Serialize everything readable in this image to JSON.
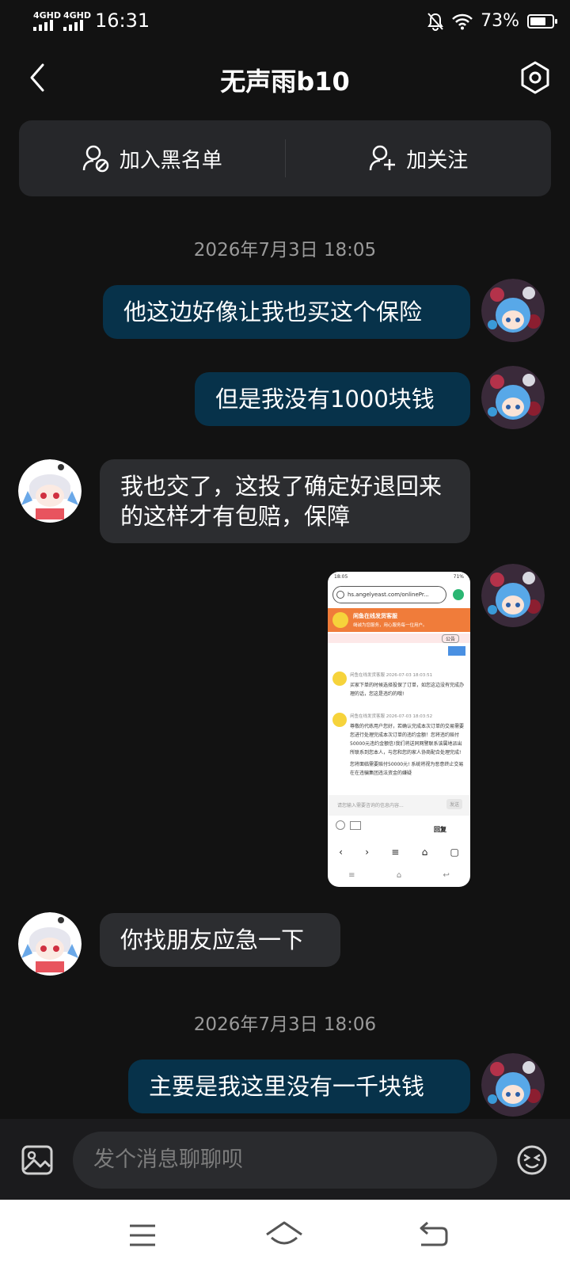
{
  "status": {
    "network1": "4GHD",
    "network2": "4GHD",
    "time": "16:31",
    "battery_text": "73%",
    "battery_level": 0.73
  },
  "header": {
    "title": "无声雨b10"
  },
  "actions": {
    "blacklist_label": "加入黑名单",
    "follow_label": "加关注"
  },
  "messages": {
    "time1": "2026年7月3日 18:05",
    "m1": "他这边好像让我也买这个保险",
    "m2": "但是我没有1000块钱",
    "m3": "我也交了，这投了确定好退回来的这样才有包赔，保障",
    "m4": "你找朋友应急一下",
    "time2": "2026年7月3日 18:06",
    "m5": "主要是我这里没有一千块钱"
  },
  "screenshot": {
    "time": "18:05",
    "battery": "71%",
    "url": "hs.angelyeast.com/onlinePr...",
    "banner_title": "闲鱼在线发货客服",
    "banner_sub": "竭诚为您服务，用心服务每一位用户。",
    "notice": "公告",
    "msg1_header": "闲鱼在线发货客服 2026-07-03 18:03:51",
    "msg1_text": "买家下单的时候选择投保了订单，如您这边没有完成办理的话，您这是违约的哦!",
    "msg2_header": "闲鱼在线发货客服 2026-07-03 18:03:52",
    "msg2_text": "尊敬的代练用户您好，若确认完成本次订单的交易需要您进行处理完成本次订单的违约金额！您将违约赔付50000元违约金额信!我们将送同网警联系该属地派出所联系到您本人，与您和您的家人协商配合处理完成!",
    "msg2_text2": "您将面临需要赔付50000元! 系统将视为恶意终止交易在在违骗集团违法资金的嫌疑",
    "input_placeholder": "请您输入需要咨询的信息内容...",
    "send": "发送",
    "reply_label": "回复"
  },
  "input": {
    "placeholder": "发个消息聊聊呗"
  }
}
